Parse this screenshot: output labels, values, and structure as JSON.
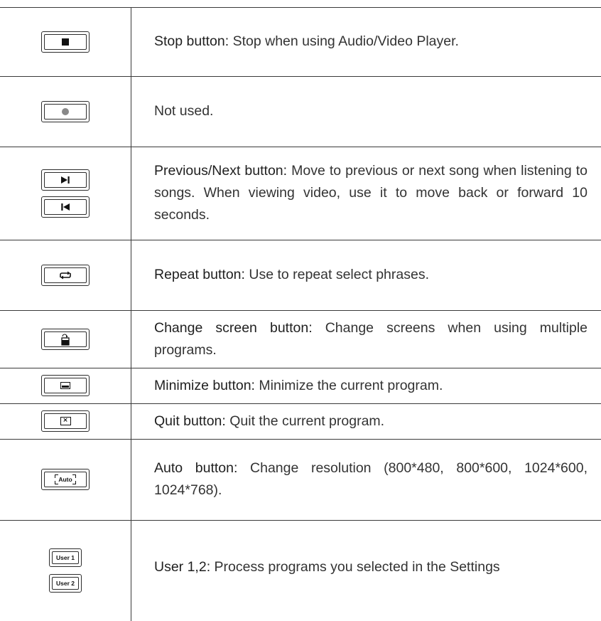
{
  "rows": [
    {
      "buttons": [
        {
          "icon": "stop-icon"
        }
      ],
      "title": "Stop button:",
      "text": " Stop when using Audio/Video Player."
    },
    {
      "buttons": [
        {
          "icon": "record-dot-icon"
        }
      ],
      "title": "",
      "text": "Not used."
    },
    {
      "buttons": [
        {
          "icon": "next-track-icon"
        },
        {
          "icon": "previous-track-icon"
        }
      ],
      "title": "Previous/Next button:",
      "text": " Move to previous or next song when listening to songs. When viewing video, use it to move back or forward 10 seconds."
    },
    {
      "buttons": [
        {
          "icon": "repeat-icon"
        }
      ],
      "title": "Repeat button:",
      "text": " Use to repeat select phrases."
    },
    {
      "buttons": [
        {
          "icon": "change-screen-icon"
        }
      ],
      "title": "Change screen button:",
      "text": " Change screens when using multiple programs."
    },
    {
      "buttons": [
        {
          "icon": "minimize-icon"
        }
      ],
      "title": "Minimize button:",
      "text": " Minimize the current program."
    },
    {
      "buttons": [
        {
          "icon": "close-x-icon"
        }
      ],
      "title": "Quit button:",
      "text": " Quit the current program."
    },
    {
      "buttons": [
        {
          "icon": "auto-icon",
          "label": "Auto"
        }
      ],
      "title": "Auto button:",
      "text": " Change resolution (800*480, 800*600, 1024*600, 1024*768)."
    },
    {
      "buttons": [
        {
          "icon": "user-key-icon",
          "label": "User 1"
        },
        {
          "icon": "user-key-icon",
          "label": "User 2"
        }
      ],
      "title": "User 1,2:",
      "text": " Process programs you selected in the Settings"
    }
  ]
}
